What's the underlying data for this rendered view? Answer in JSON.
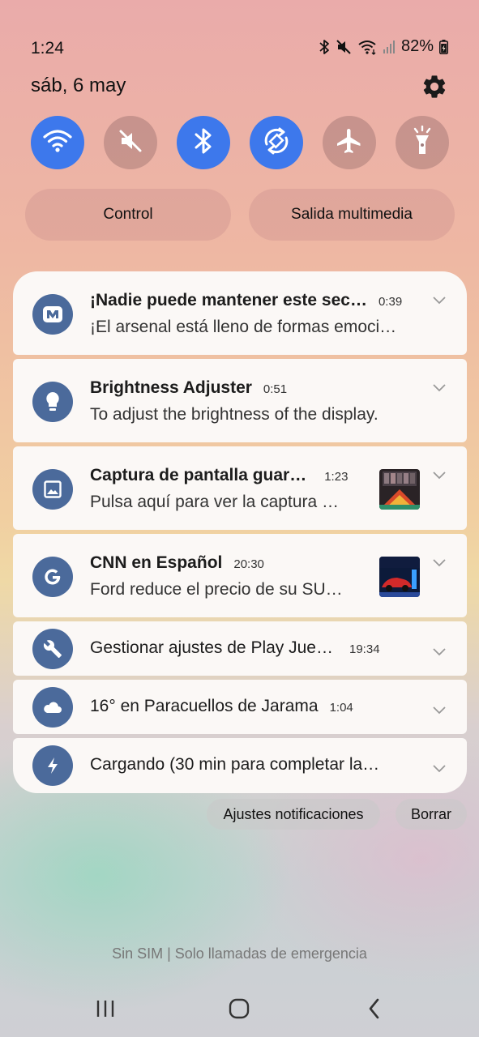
{
  "status_bar": {
    "time": "1:24",
    "battery": "82%",
    "icons": [
      "bluetooth-icon",
      "mute-icon",
      "wifi-icon",
      "signal-icon",
      "battery-icon"
    ]
  },
  "header": {
    "date": "sáb, 6 may",
    "settings_icon": "gear-icon"
  },
  "quick_settings": [
    {
      "name": "wifi",
      "icon": "wifi-icon",
      "state": "on"
    },
    {
      "name": "sound",
      "icon": "mute-icon",
      "state": "off"
    },
    {
      "name": "bluetooth",
      "icon": "bluetooth-icon",
      "state": "on"
    },
    {
      "name": "auto-rotate",
      "icon": "rotate-icon",
      "state": "on"
    },
    {
      "name": "airplane",
      "icon": "airplane-icon",
      "state": "off"
    },
    {
      "name": "flashlight",
      "icon": "flashlight-icon",
      "state": "off"
    }
  ],
  "pills": {
    "control": "Control",
    "media_output": "Salida multimedia"
  },
  "notifications": [
    {
      "app_icon": "game-app-icon",
      "title": "¡Nadie puede mantener este sec…",
      "time": "0:39",
      "body": "¡El arsenal está lleno de formas emoci…"
    },
    {
      "app_icon": "bulb-icon",
      "title": "Brightness Adjuster",
      "time": "0:51",
      "body": "To adjust the brightness of the display."
    },
    {
      "app_icon": "image-icon",
      "title": "Captura de pantalla guar…",
      "time": "1:23",
      "body": "Pulsa aquí para ver la captura …",
      "thumbnail": "screenshot-thumbnail"
    },
    {
      "app_icon": "google-icon",
      "title": "CNN en Español",
      "time": "20:30",
      "body": "Ford reduce el precio de su SU…",
      "thumbnail": "car-thumbnail"
    },
    {
      "app_icon": "wrench-icon",
      "title": "Gestionar ajustes de Play Jue…",
      "time": "19:34"
    },
    {
      "app_icon": "cloud-icon",
      "title": "16° en Paracuellos de Jarama",
      "time": "1:04"
    },
    {
      "app_icon": "charging-icon",
      "title": "Cargando (30 min para completar la…"
    }
  ],
  "footer": {
    "notif_settings": "Ajustes notificaciones",
    "clear": "Borrar",
    "sim_status": "Sin SIM | Solo llamadas de emergencia"
  },
  "nav": {
    "recents": "recents-icon",
    "home": "home-icon",
    "back": "back-icon"
  },
  "colors": {
    "accent": "#3d78ec",
    "app_icon_bg": "#4b6a9b",
    "card_bg": "#fbf8f6"
  }
}
